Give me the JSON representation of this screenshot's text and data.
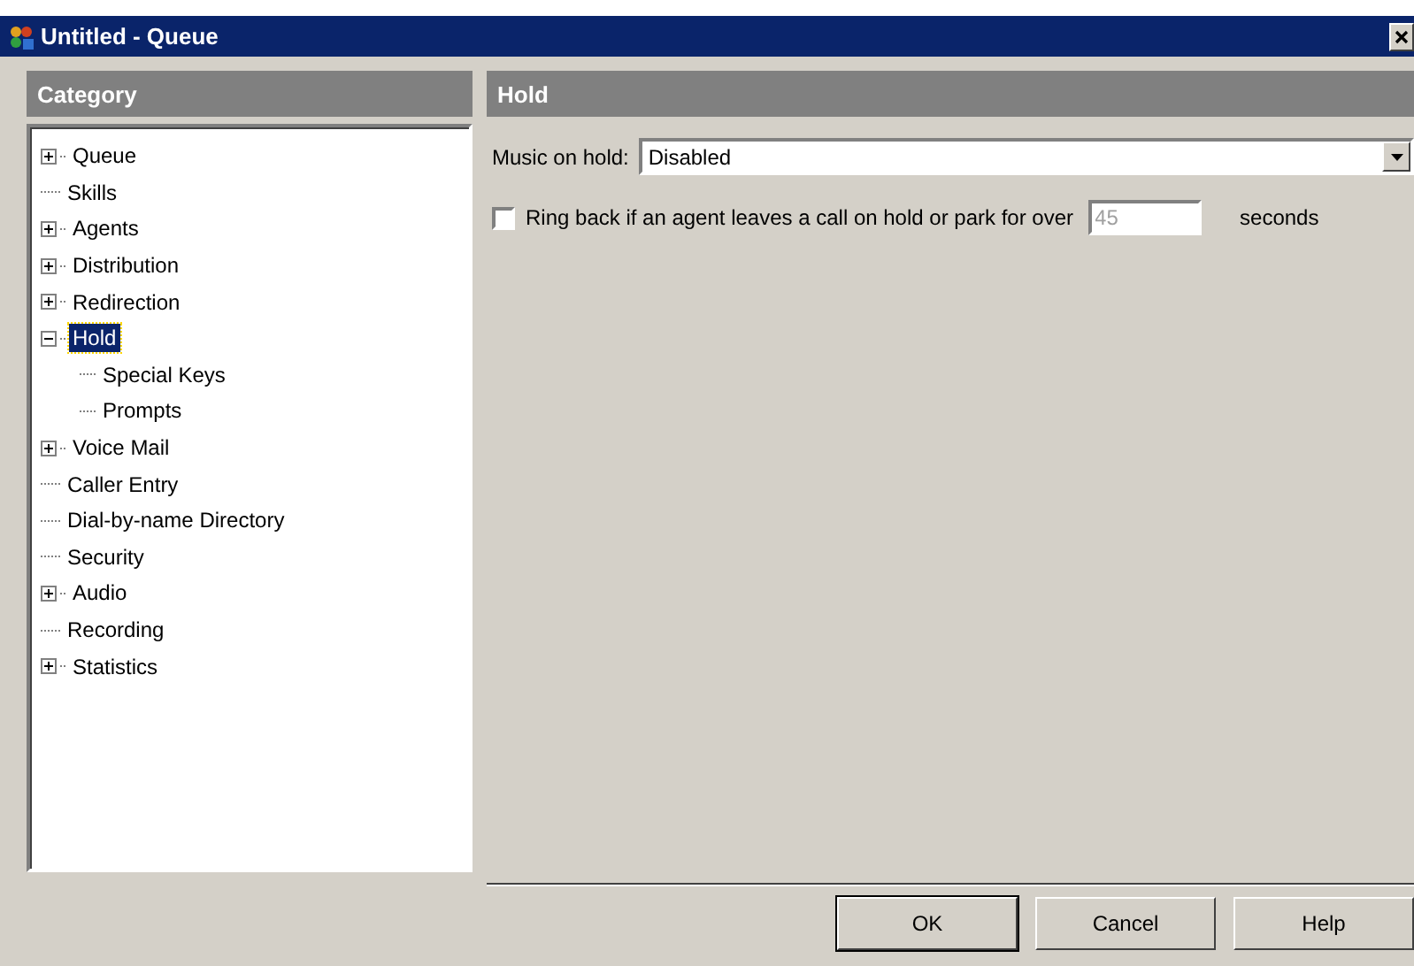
{
  "window": {
    "title": "Untitled - Queue"
  },
  "category": {
    "title": "Category",
    "items": [
      {
        "label": "Queue",
        "expanded": false,
        "selected": false
      },
      {
        "label": "Skills",
        "selected": false
      },
      {
        "label": "Agents",
        "expanded": false,
        "selected": false
      },
      {
        "label": "Distribution",
        "expanded": false,
        "selected": false
      },
      {
        "label": "Redirection",
        "expanded": false,
        "selected": false
      },
      {
        "label": "Hold",
        "expanded": true,
        "selected": true,
        "children": [
          {
            "label": "Special Keys",
            "selected": false
          },
          {
            "label": "Prompts",
            "selected": false
          }
        ]
      },
      {
        "label": "Voice Mail",
        "expanded": false,
        "selected": false
      },
      {
        "label": "Caller Entry",
        "selected": false
      },
      {
        "label": "Dial-by-name Directory",
        "selected": false
      },
      {
        "label": "Security",
        "selected": false
      },
      {
        "label": "Audio",
        "expanded": false,
        "selected": false
      },
      {
        "label": "Recording",
        "selected": false
      },
      {
        "label": "Statistics",
        "expanded": false,
        "selected": false
      }
    ]
  },
  "panel": {
    "title": "Hold",
    "music_on_hold": {
      "label": "Music on hold:",
      "value": "Disabled"
    },
    "ring_back": {
      "label": "Ring back if an agent leaves a call on hold or park for over",
      "checked": false,
      "value": "45",
      "disabled": true,
      "unit": "seconds"
    }
  },
  "buttons": [
    {
      "label": "OK",
      "default": true
    },
    {
      "label": "Cancel",
      "default": false
    },
    {
      "label": "Help",
      "default": false
    }
  ]
}
